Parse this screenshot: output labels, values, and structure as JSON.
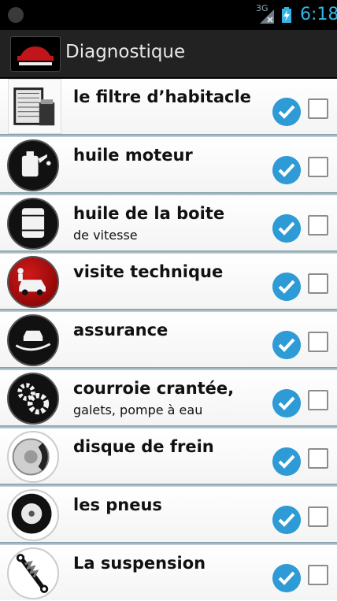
{
  "status_bar": {
    "network_label": "3G",
    "time": "6:18",
    "time_color": "#33b5e5",
    "icons": [
      "notification-icon",
      "signal-icon",
      "battery-charging-icon"
    ]
  },
  "action_bar": {
    "title": "Diagnostique",
    "logo_icon": "car-logo-icon",
    "background": "#222222"
  },
  "items": [
    {
      "title": "le filtre d’habitacle",
      "subtitle": "",
      "icon": "cabin-filter-icon",
      "checked_indicator": true,
      "checkbox_checked": false
    },
    {
      "title": "huile moteur",
      "subtitle": "",
      "icon": "oil-can-icon",
      "checked_indicator": true,
      "checkbox_checked": false
    },
    {
      "title": "huile de la boite",
      "subtitle": "de vitesse",
      "icon": "oil-barrel-icon",
      "checked_indicator": true,
      "checkbox_checked": false
    },
    {
      "title": "visite technique",
      "subtitle": "",
      "icon": "car-inspection-icon",
      "checked_indicator": true,
      "checkbox_checked": false
    },
    {
      "title": "assurance",
      "subtitle": "",
      "icon": "car-insurance-hand-icon",
      "checked_indicator": true,
      "checkbox_checked": false
    },
    {
      "title": "courroie crantée,",
      "subtitle": "galets, pompe à eau",
      "icon": "gears-icon",
      "checked_indicator": true,
      "checkbox_checked": false
    },
    {
      "title": "disque de frein",
      "subtitle": "",
      "icon": "brake-disc-icon",
      "checked_indicator": true,
      "checkbox_checked": false
    },
    {
      "title": "les pneus",
      "subtitle": "",
      "icon": "tire-icon",
      "checked_indicator": true,
      "checkbox_checked": false
    },
    {
      "title": "La suspension",
      "subtitle": "",
      "icon": "shock-absorber-icon",
      "checked_indicator": true,
      "checkbox_checked": false
    }
  ],
  "colors": {
    "check_indicator": "#2e9bd6",
    "divider": "#7f9aa6"
  }
}
